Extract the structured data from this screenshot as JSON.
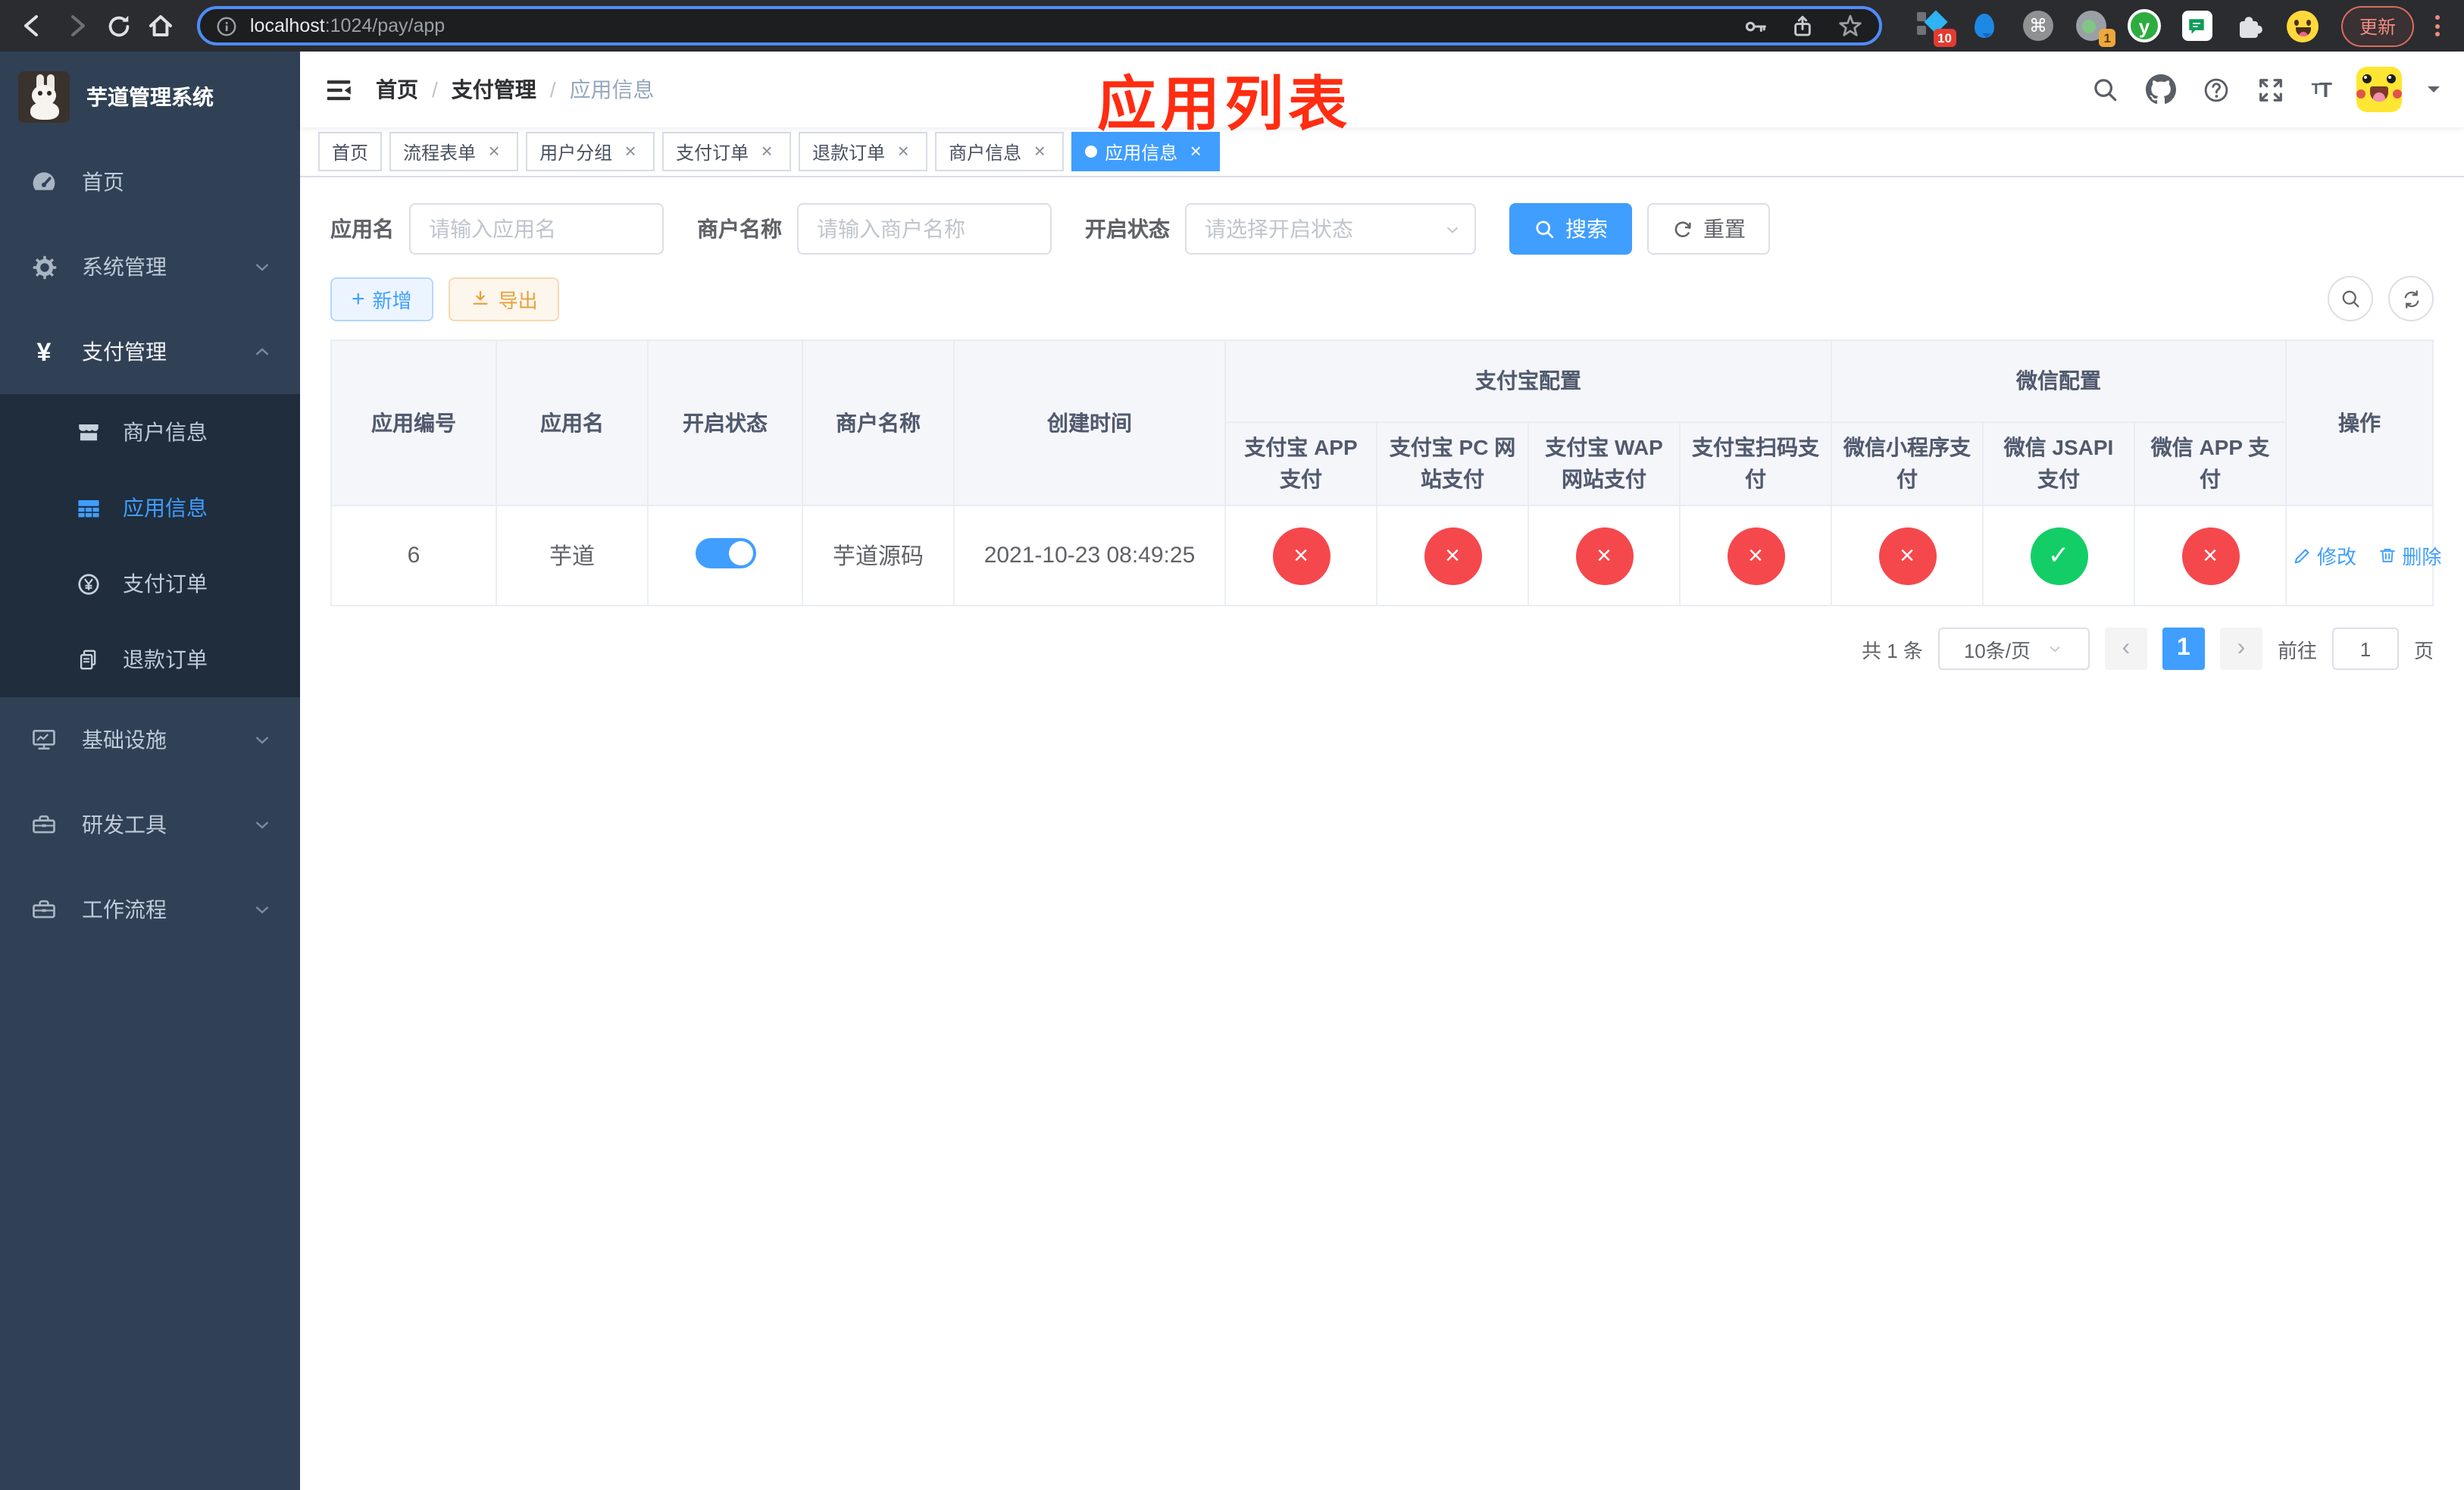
{
  "browser": {
    "url_host": "localhost",
    "url_rest": ":1024/pay/app",
    "update_label": "更新",
    "extensions": {
      "pin_badge_1": "10",
      "pin_badge_2": "1",
      "cmd_symbol": "⌘",
      "y_letter": "y"
    }
  },
  "sidebar": {
    "title": "芋道管理系统",
    "items": [
      {
        "label": "首页",
        "icon": "dashboard-icon"
      },
      {
        "label": "系统管理",
        "icon": "gear-icon",
        "chevron": "down"
      },
      {
        "label": "支付管理",
        "icon": "yen-icon",
        "chevron": "up",
        "active": true
      },
      {
        "label": "基础设施",
        "icon": "monitor-icon",
        "chevron": "down"
      },
      {
        "label": "研发工具",
        "icon": "toolbox-icon",
        "chevron": "down"
      },
      {
        "label": "工作流程",
        "icon": "workflow-icon",
        "chevron": "down"
      }
    ],
    "submenu": [
      {
        "label": "商户信息",
        "icon": "store-icon"
      },
      {
        "label": "应用信息",
        "icon": "grid-icon",
        "active": true
      },
      {
        "label": "支付订单",
        "icon": "yen-circle-icon"
      },
      {
        "label": "退款订单",
        "icon": "document-icon"
      }
    ]
  },
  "navbar": {
    "breadcrumb": {
      "items": [
        "首页",
        "支付管理",
        "应用信息"
      ],
      "separator": "/"
    },
    "annotation": "应用列表"
  },
  "tabs": {
    "close_symbol": "×",
    "items": [
      {
        "label": "首页",
        "closable": false,
        "active": false
      },
      {
        "label": "流程表单",
        "closable": true,
        "active": false
      },
      {
        "label": "用户分组",
        "closable": true,
        "active": false
      },
      {
        "label": "支付订单",
        "closable": true,
        "active": false
      },
      {
        "label": "退款订单",
        "closable": true,
        "active": false
      },
      {
        "label": "商户信息",
        "closable": true,
        "active": false
      },
      {
        "label": "应用信息",
        "closable": true,
        "active": true
      }
    ]
  },
  "filter": {
    "app_name_label": "应用名",
    "app_name_placeholder": "请输入应用名",
    "merchant_label": "商户名称",
    "merchant_placeholder": "请输入商户名称",
    "status_label": "开启状态",
    "status_placeholder": "请选择开启状态",
    "search_label": "搜索",
    "reset_label": "重置"
  },
  "toolbar": {
    "add_label": "新增",
    "plus_symbol": "+",
    "export_label": "导出"
  },
  "table": {
    "group_headers": {
      "alipay": "支付宝配置",
      "wechat": "微信配置"
    },
    "columns": {
      "app_id": "应用编号",
      "app_name": "应用名",
      "status": "开启状态",
      "merchant": "商户名称",
      "created": "创建时间",
      "alipay_app": "支付宝 APP 支付",
      "alipay_pc": "支付宝 PC 网站支付",
      "alipay_wap": "支付宝 WAP 网站支付",
      "alipay_qr": "支付宝扫码支付",
      "wx_mini": "微信小程序支付",
      "wx_jsapi": "微信 JSAPI 支付",
      "wx_app": "微信 APP 支付",
      "actions": "操作"
    },
    "row": {
      "app_id": "6",
      "app_name": "芋道",
      "enabled": true,
      "merchant": "芋道源码",
      "created": "2021-10-23 08:49:25",
      "statuses": [
        {
          "state": "off",
          "symbol": "×"
        },
        {
          "state": "off",
          "symbol": "×"
        },
        {
          "state": "off",
          "symbol": "×"
        },
        {
          "state": "off",
          "symbol": "×"
        },
        {
          "state": "off",
          "symbol": "×"
        },
        {
          "state": "on",
          "symbol": "✓"
        },
        {
          "state": "off",
          "symbol": "×"
        }
      ],
      "edit_label": "修改",
      "delete_label": "删除"
    }
  },
  "pagination": {
    "total": "共 1 条",
    "page_size": "10条/页",
    "prev": "‹",
    "page": "1",
    "next": "›",
    "goto_prefix": "前往",
    "goto_value": "1",
    "goto_suffix": "页"
  },
  "colors": {
    "accent": "#409eff",
    "danger": "#f5484d",
    "success": "#13ce66",
    "warning": "#e6a23c",
    "sidebar_bg": "#304156",
    "submenu_bg": "#1f2d3d",
    "annotation": "#ff2d12"
  }
}
